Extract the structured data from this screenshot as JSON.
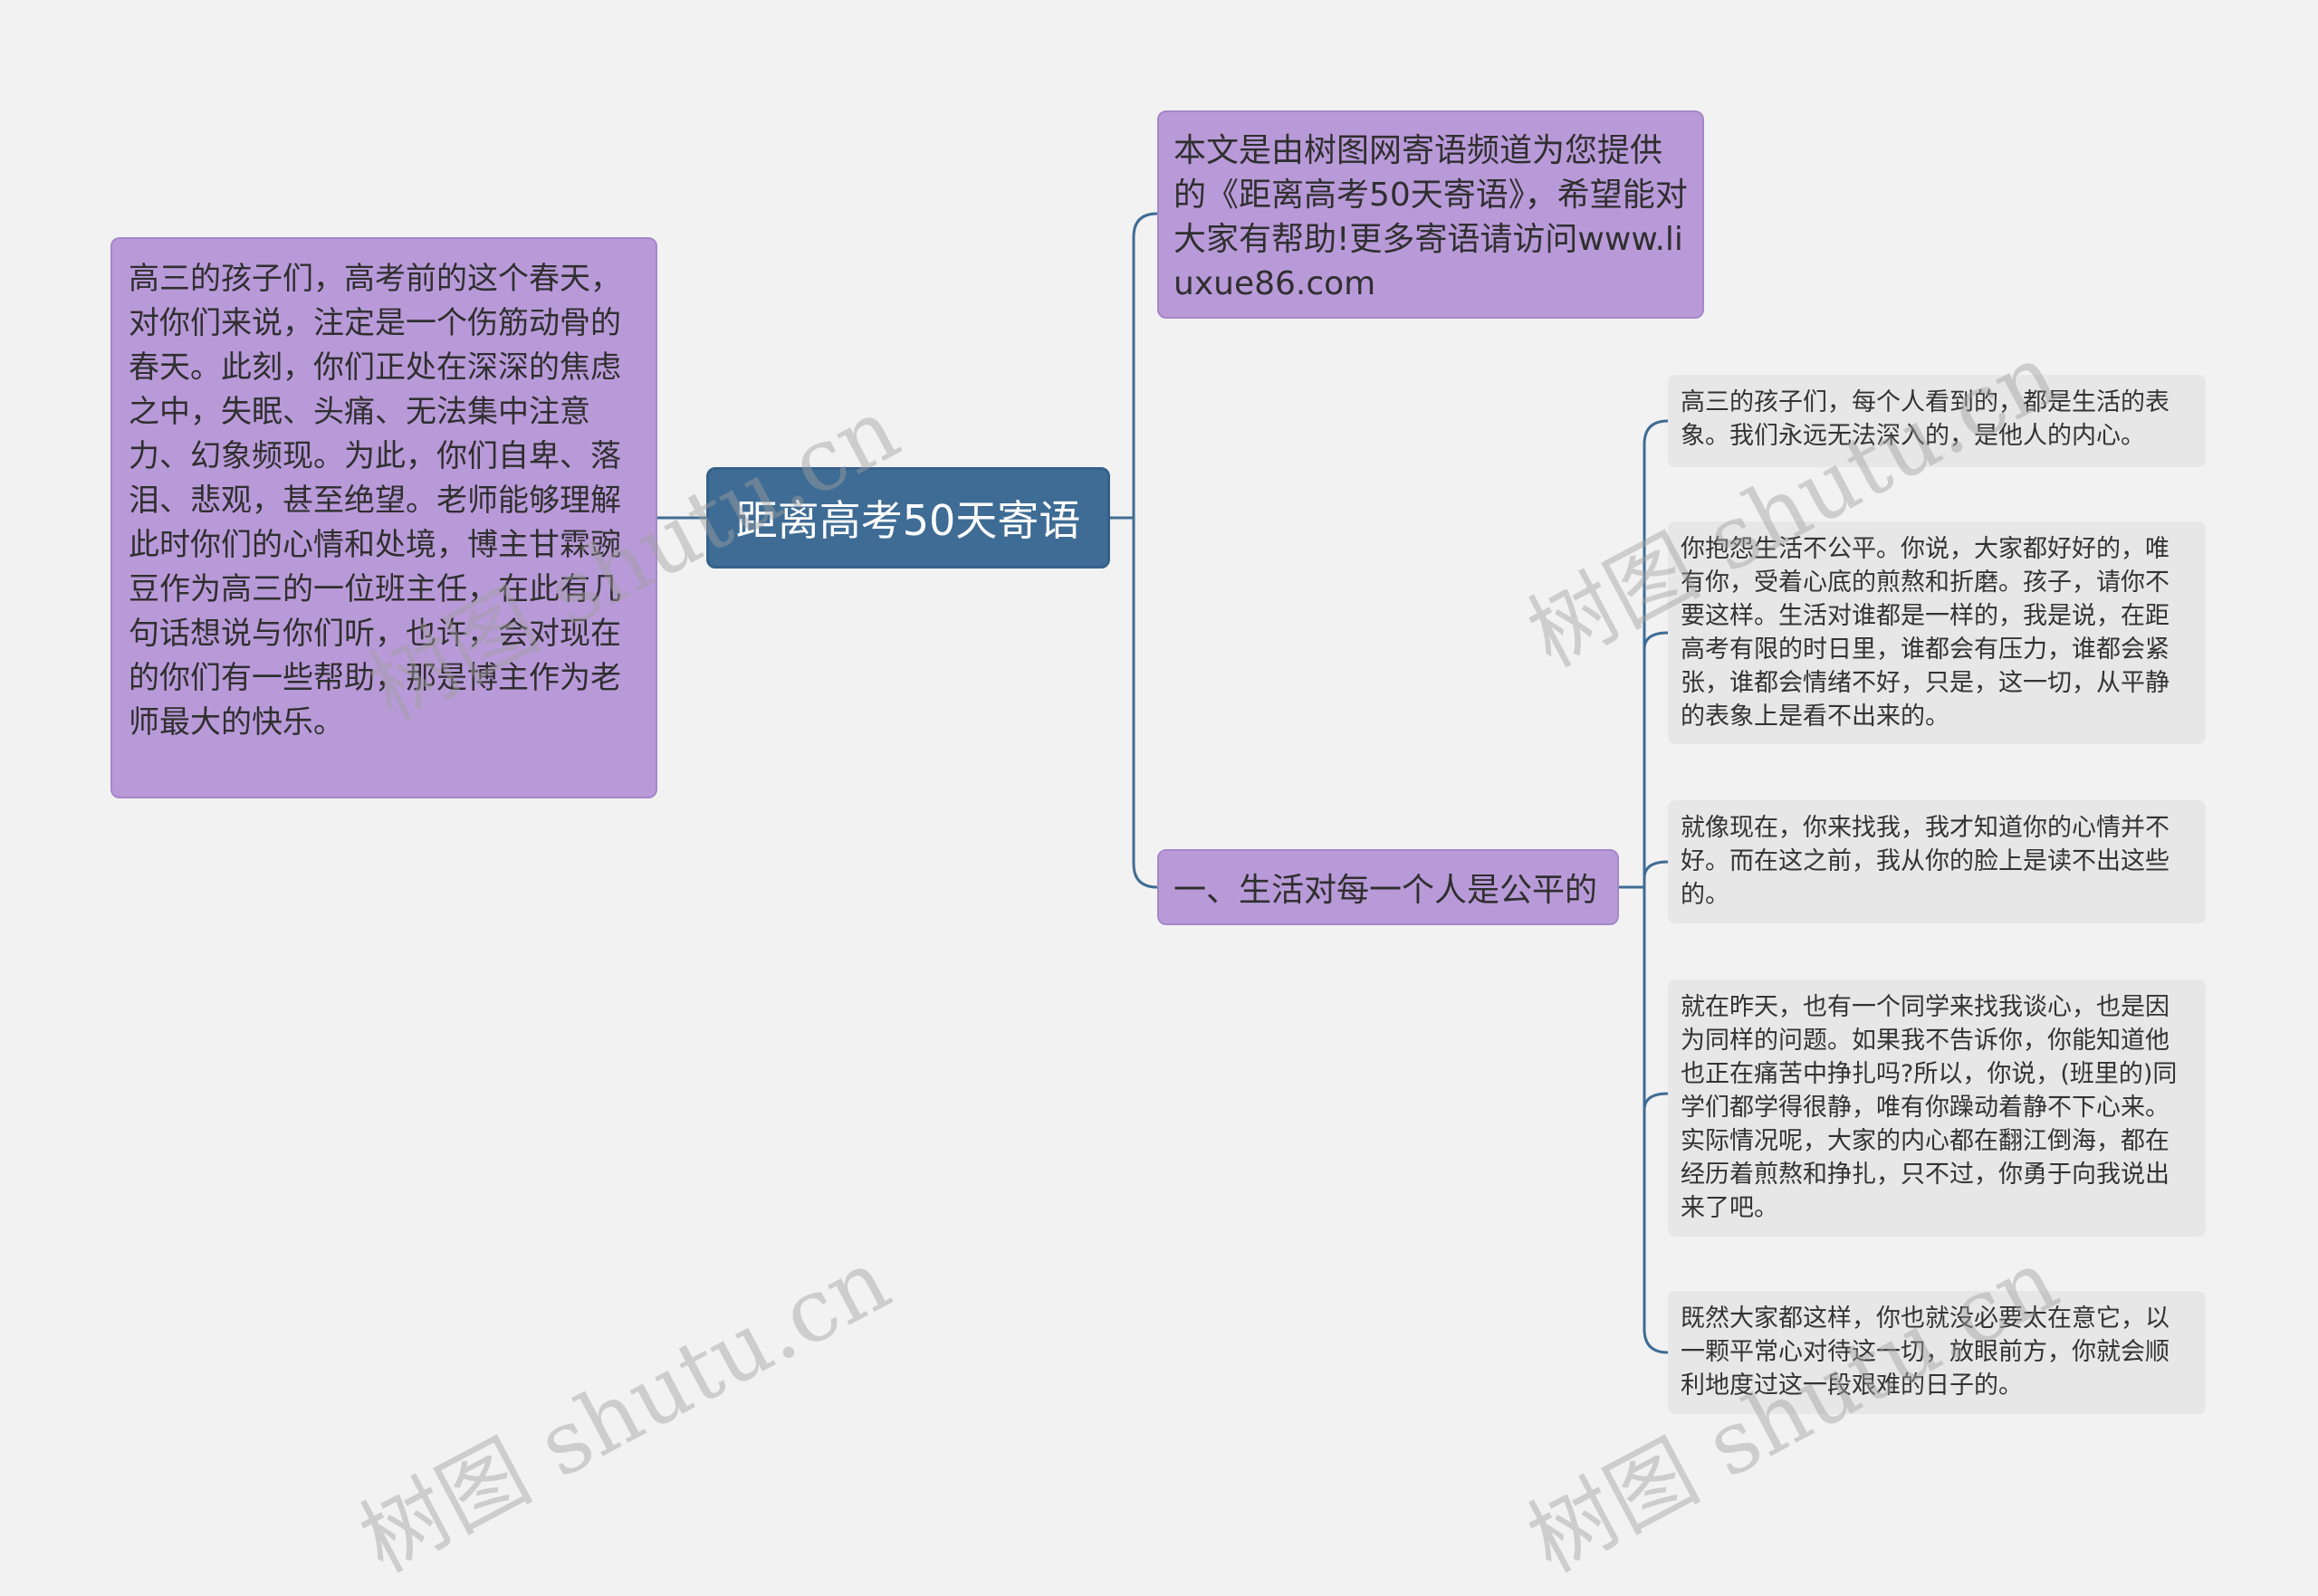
{
  "root": {
    "title": "距离高考50天寄语"
  },
  "left_note": "高三的孩子们，高考前的这个春天，对你们来说，注定是一个伤筋动骨的春天。此刻，你们正处在深深的焦虑之中，失眠、头痛、无法集中注意力、幻象频现。为此，你们自卑、落泪、悲观，甚至绝望。老师能够理解此时你们的心情和处境，博主甘霖豌豆作为高三的一位班主任，在此有几句话想说与你们听，也许，会对现在的你们有一些帮助，那是博主作为老师最大的快乐。",
  "intro_note": "本文是由树图网寄语频道为您提供的《距离高考50天寄语》，希望能对大家有帮助!更多寄语请访问www.liuxue86.com",
  "topic": {
    "label": "一、生活对每一个人是公平的"
  },
  "leaves": [
    "高三的孩子们，每个人看到的，都是生活的表象。我们永远无法深入的，是他人的内心。",
    "你抱怨生活不公平。你说，大家都好好的，唯有你，受着心底的煎熬和折磨。孩子，请你不要这样。生活对谁都是一样的，我是说，在距高考有限的时日里，谁都会有压力，谁都会紧张，谁都会情绪不好，只是，这一切，从平静的表象上是看不出来的。",
    "就像现在，你来找我，我才知道你的心情并不好。而在这之前，我从你的脸上是读不出这些的。",
    "就在昨天，也有一个同学来找我谈心，也是因为同样的问题。如果我不告诉你，你能知道他也正在痛苦中挣扎吗?所以，你说，(班里的)同学们都学得很静，唯有你躁动着静不下心来。实际情况呢，大家的内心都在翻江倒海，都在经历着煎熬和挣扎，只不过，你勇于向我说出来了吧。",
    "既然大家都这样，你也就没必要太在意它，以一颗平常心对待这一切，放眼前方，你就会顺利地度过这一段艰难的日子的。"
  ],
  "watermark": "树图 shutu.cn",
  "colors": {
    "background": "#f2f2f2",
    "root_fill": "#3f6c94",
    "branch_fill": "#b99ad9",
    "leaf_fill": "#e7e7e7",
    "connector": "#3f6c94"
  }
}
